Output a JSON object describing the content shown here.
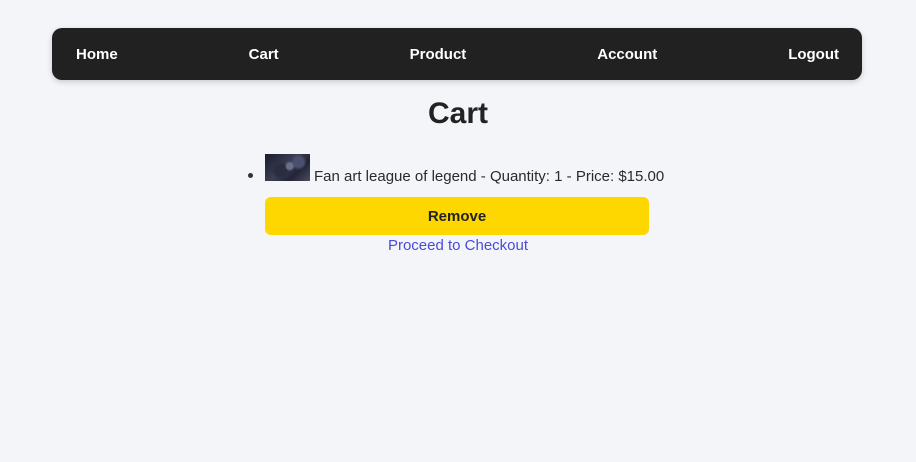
{
  "nav": {
    "home": "Home",
    "cart": "Cart",
    "product": "Product",
    "account": "Account",
    "logout": "Logout"
  },
  "main": {
    "title": "Cart",
    "items": [
      {
        "text": "Fan art league of legend - Quantity: 1 - Price: $15.00",
        "remove_label": "Remove"
      }
    ],
    "checkout_label": "Proceed to Checkout"
  },
  "colors": {
    "navbar": "#212121",
    "background": "#f4f5f9",
    "remove_button": "#ffd700",
    "link": "#4a4adb"
  }
}
